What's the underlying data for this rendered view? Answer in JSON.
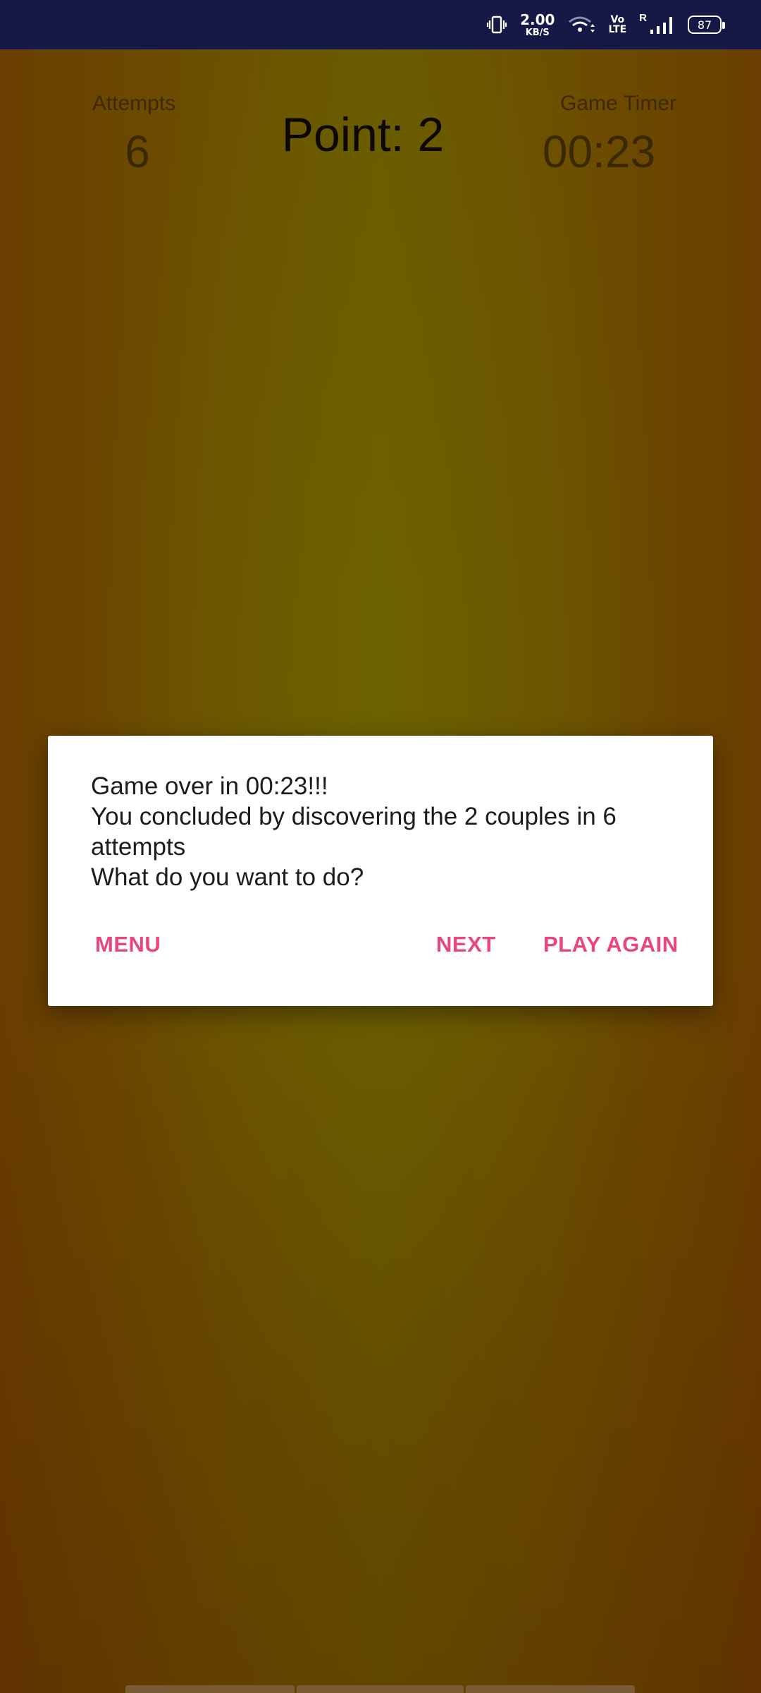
{
  "status_bar": {
    "vibrate_icon": "vibrate-icon",
    "network_speed": "2.00",
    "network_speed_unit": "KB/S",
    "wifi_icon": "wifi-icon",
    "volte_top": "Vo",
    "volte_bottom": "LTE",
    "roaming": "R",
    "signal_icon": "signal-icon",
    "battery": "87"
  },
  "game": {
    "attempts_label": "Attempts",
    "attempts_value": "6",
    "point_label": "Point: 2",
    "timer_label": "Game Timer",
    "timer_value": "00:23"
  },
  "dialog": {
    "line1": "Game over in 00:23!!!",
    "line2": "You concluded by discovering the 2 couples in 6 attempts",
    "line3": "What do you want to do?",
    "menu_button": "MENU",
    "next_button": "NEXT",
    "play_again_button": "PLAY AGAIN"
  },
  "colors": {
    "status_bar_bg": "#141a45",
    "accent": "#e8467c",
    "background_brown": "#6a3e00",
    "background_olive": "#6a5a00"
  }
}
